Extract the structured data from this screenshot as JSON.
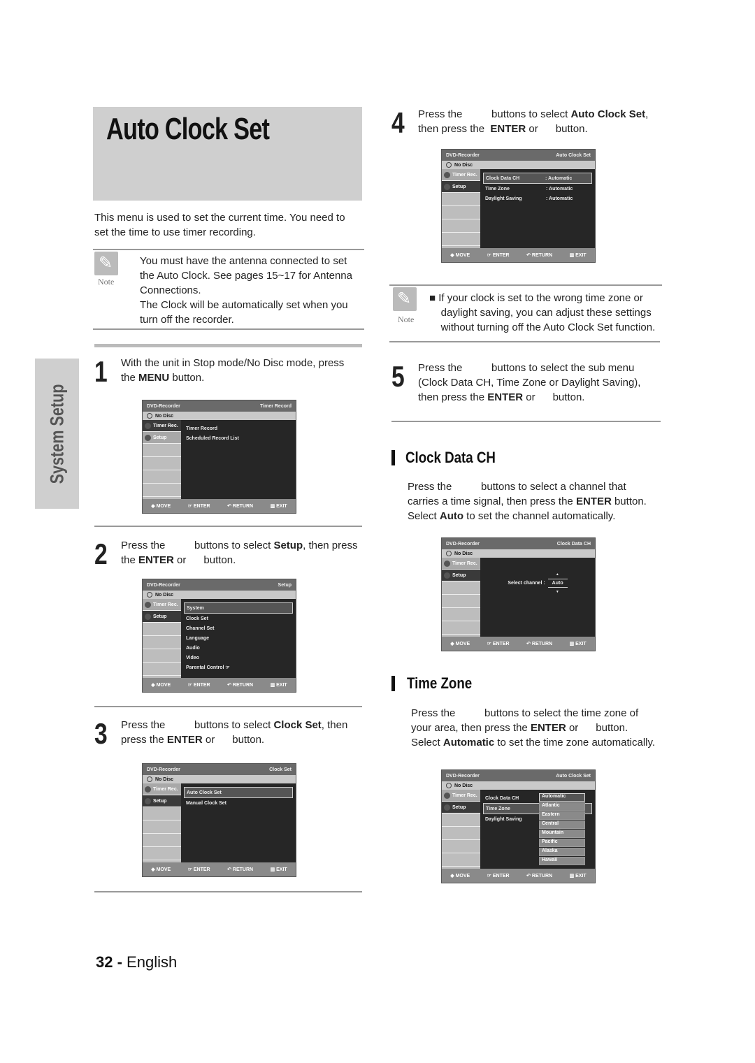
{
  "title": "Auto Clock Set",
  "side_tab": "System Setup",
  "page_number": "32 -",
  "page_language": "English",
  "intro": [
    [
      {
        "t": "This menu is used to set the current time. You need to"
      }
    ],
    [
      {
        "t": "set the time to use timer recording."
      }
    ]
  ],
  "note_label": "Note",
  "note1": [
    [
      {
        "t": "You must have the antenna connected to set"
      }
    ],
    [
      {
        "t": "the Auto Clock. See pages 15~17 for Antenna"
      }
    ],
    [
      {
        "t": "Connections."
      }
    ],
    [
      {
        "t": "The Clock will be automatically set when you"
      }
    ],
    [
      {
        "t": "turn off the recorder."
      }
    ]
  ],
  "note2": [
    [
      {
        "t": "■ If your clock is set to the wrong time zone or"
      }
    ],
    [
      {
        "t": "    daylight saving, you can adjust these settings"
      }
    ],
    [
      {
        "t": "    without turning off the Auto Clock Set function."
      }
    ]
  ],
  "steps": [
    {
      "num": "1",
      "lines": [
        [
          {
            "t": "With the unit in Stop mode/No Disc mode, press"
          }
        ],
        [
          {
            "t": "the "
          },
          {
            "t": "MENU",
            "b": true
          },
          {
            "t": " button."
          }
        ]
      ]
    },
    {
      "num": "2",
      "lines": [
        [
          {
            "t": "Press the          buttons to select "
          },
          {
            "t": "Setup",
            "b": true
          },
          {
            "t": ", then press"
          }
        ],
        [
          {
            "t": "the "
          },
          {
            "t": "ENTER",
            "b": true
          },
          {
            "t": " or      button."
          }
        ]
      ]
    },
    {
      "num": "3",
      "lines": [
        [
          {
            "t": "Press the          buttons to select "
          },
          {
            "t": "Clock Set",
            "b": true
          },
          {
            "t": ", then"
          }
        ],
        [
          {
            "t": "press the "
          },
          {
            "t": "ENTER",
            "b": true
          },
          {
            "t": " or      button."
          }
        ]
      ]
    },
    {
      "num": "4",
      "lines": [
        [
          {
            "t": "Press the          buttons to select "
          },
          {
            "t": "Auto Clock Set",
            "b": true
          },
          {
            "t": ","
          }
        ],
        [
          {
            "t": "then press the  "
          },
          {
            "t": "ENTER",
            "b": true
          },
          {
            "t": " or      button."
          }
        ]
      ]
    },
    {
      "num": "5",
      "lines": [
        [
          {
            "t": "Press the          buttons to select the sub menu"
          }
        ],
        [
          {
            "t": "(Clock Data CH, Time Zone or Daylight Saving),"
          }
        ],
        [
          {
            "t": "then press the "
          },
          {
            "t": "ENTER",
            "b": true
          },
          {
            "t": " or      button."
          }
        ]
      ]
    }
  ],
  "sections": [
    {
      "heading": "Clock Data CH",
      "lines": [
        [
          {
            "t": "Press the          buttons to select a channel that"
          }
        ],
        [
          {
            "t": "carries a time signal, then press the "
          },
          {
            "t": "ENTER",
            "b": true
          },
          {
            "t": " button."
          }
        ],
        [
          {
            "t": "Select "
          },
          {
            "t": "Auto",
            "b": true
          },
          {
            "t": " to set the channel automatically."
          }
        ]
      ]
    },
    {
      "heading": "Time Zone",
      "lines": [
        [
          {
            "t": "Press the          buttons to select the time zone of"
          }
        ],
        [
          {
            "t": "your area, then press the "
          },
          {
            "t": "ENTER",
            "b": true
          },
          {
            "t": " or      button."
          }
        ],
        [
          {
            "t": "Select "
          },
          {
            "t": "Automatic",
            "b": true
          },
          {
            "t": " to set the time zone automatically."
          }
        ]
      ]
    }
  ],
  "osd_footer": [
    "◆ MOVE",
    "☞ ENTER",
    "↶ RETURN",
    "▥ EXIT"
  ],
  "osds": [
    {
      "header_left": "DVD-Recorder",
      "header_right": "Timer Record",
      "disc": "No Disc",
      "tabs": [
        {
          "label": "Timer Rec.",
          "active": true
        },
        {
          "label": "Setup",
          "active": false
        }
      ],
      "items": [
        {
          "label": "Timer Record"
        },
        {
          "label": "Scheduled Record List"
        }
      ]
    },
    {
      "header_left": "DVD-Recorder",
      "header_right": "Setup",
      "disc": "No Disc",
      "tabs": [
        {
          "label": "Timer Rec.",
          "active": false
        },
        {
          "label": "Setup",
          "active": true
        }
      ],
      "items": [
        {
          "label": "System",
          "selected": true
        },
        {
          "label": "Clock Set"
        },
        {
          "label": "Channel Set"
        },
        {
          "label": "Language"
        },
        {
          "label": "Audio"
        },
        {
          "label": "Video"
        },
        {
          "label": "Parental Control ☞"
        }
      ]
    },
    {
      "header_left": "DVD-Recorder",
      "header_right": "Clock Set",
      "disc": "No Disc",
      "tabs": [
        {
          "label": "Timer Rec.",
          "active": false
        },
        {
          "label": "Setup",
          "active": true
        }
      ],
      "items": [
        {
          "label": "Auto Clock Set",
          "selected": true
        },
        {
          "label": "Manual Clock Set"
        }
      ]
    },
    {
      "header_left": "DVD-Recorder",
      "header_right": "Auto Clock Set",
      "disc": "No Disc",
      "tabs": [
        {
          "label": "Timer Rec.",
          "active": false
        },
        {
          "label": "Setup",
          "active": true
        }
      ],
      "items": [
        {
          "label": "Clock Data CH",
          "value": ": Automatic",
          "selected": true
        },
        {
          "label": "Time Zone",
          "value": ": Automatic"
        },
        {
          "label": "Daylight Saving",
          "value": ": Automatic"
        }
      ]
    },
    {
      "header_left": "DVD-Recorder",
      "header_right": "Clock Data CH",
      "disc": "No Disc",
      "tabs": [
        {
          "label": "Timer Rec.",
          "active": false
        },
        {
          "label": "Setup",
          "active": true
        }
      ],
      "spinner": {
        "label": "Select channel   :",
        "value": "Auto"
      },
      "items": []
    },
    {
      "header_left": "DVD-Recorder",
      "header_right": "Auto Clock Set",
      "disc": "No Disc",
      "tabs": [
        {
          "label": "Timer Rec.",
          "active": false
        },
        {
          "label": "Setup",
          "active": true
        }
      ],
      "items": [
        {
          "label": "Clock Data CH"
        },
        {
          "label": "Time Zone",
          "selected": true
        },
        {
          "label": "Daylight Saving"
        }
      ],
      "dropdown": [
        {
          "label": "Automatic",
          "selected": true
        },
        {
          "label": "Atlantic"
        },
        {
          "label": "Eastern"
        },
        {
          "label": "Central"
        },
        {
          "label": "Mountain"
        },
        {
          "label": "Pacific"
        },
        {
          "label": "Alaska"
        },
        {
          "label": "Hawaii"
        }
      ]
    }
  ]
}
